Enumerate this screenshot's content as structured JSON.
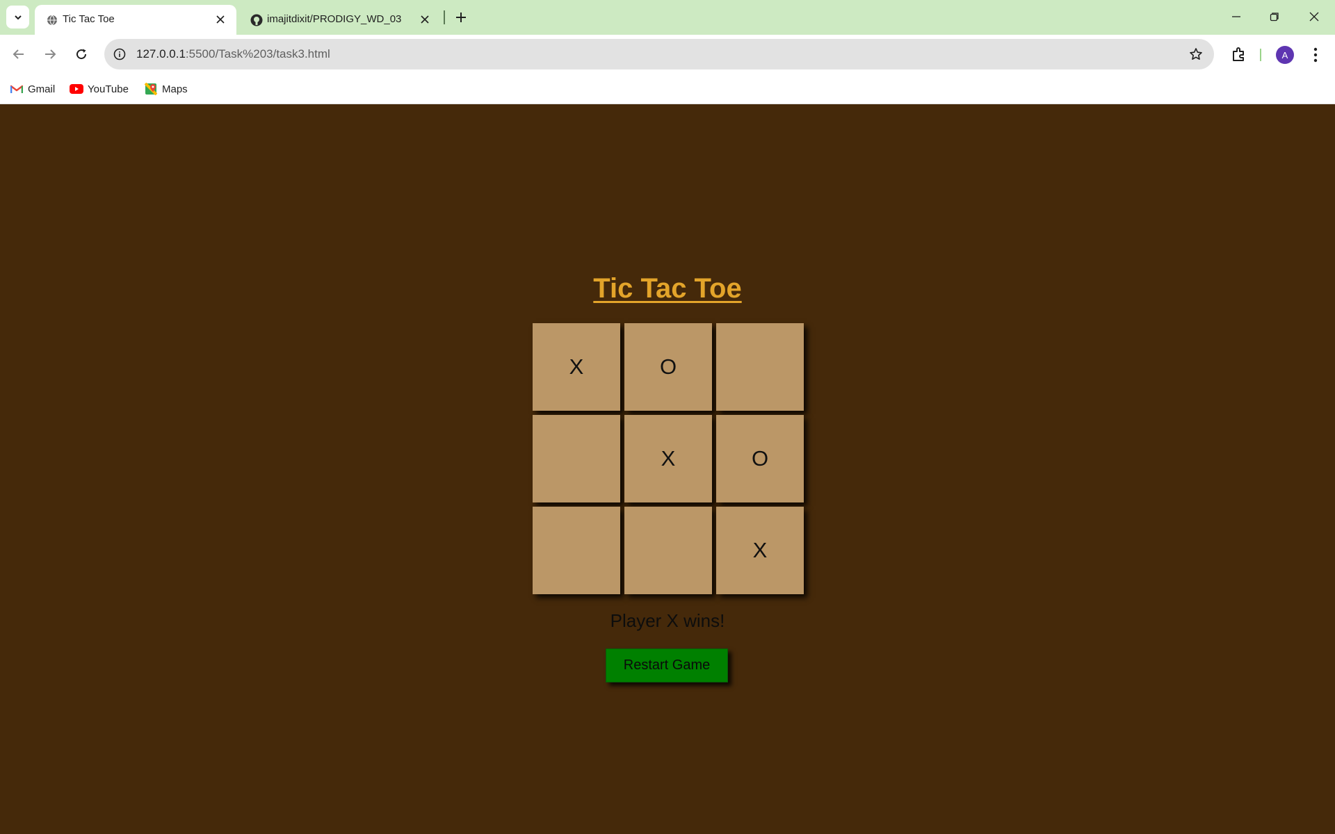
{
  "browser": {
    "tabs": [
      {
        "title": "Tic Tac Toe",
        "active": true,
        "icon": "globe-icon"
      },
      {
        "title": "imajitdixit/PRODIGY_WD_03",
        "active": false,
        "icon": "github-icon"
      }
    ],
    "url_host": "127.0.0.1",
    "url_rest": ":5500/Task%203/task3.html",
    "profile_initial": "A",
    "bookmarks": [
      {
        "label": "Gmail",
        "icon": "gmail-icon"
      },
      {
        "label": "YouTube",
        "icon": "youtube-icon"
      },
      {
        "label": "Maps",
        "icon": "maps-icon"
      }
    ]
  },
  "game": {
    "title": "Tic Tac Toe",
    "board": [
      [
        "X",
        "O",
        ""
      ],
      [
        "",
        "X",
        "O"
      ],
      [
        "",
        "",
        "X"
      ]
    ],
    "status": "Player X wins!",
    "restart_label": "Restart Game"
  },
  "colors": {
    "page_background": "#45290a",
    "title": "#e3a42a",
    "cell": "#bb9767",
    "restart_button": "#008000",
    "tab_strip": "#cdeac2"
  }
}
